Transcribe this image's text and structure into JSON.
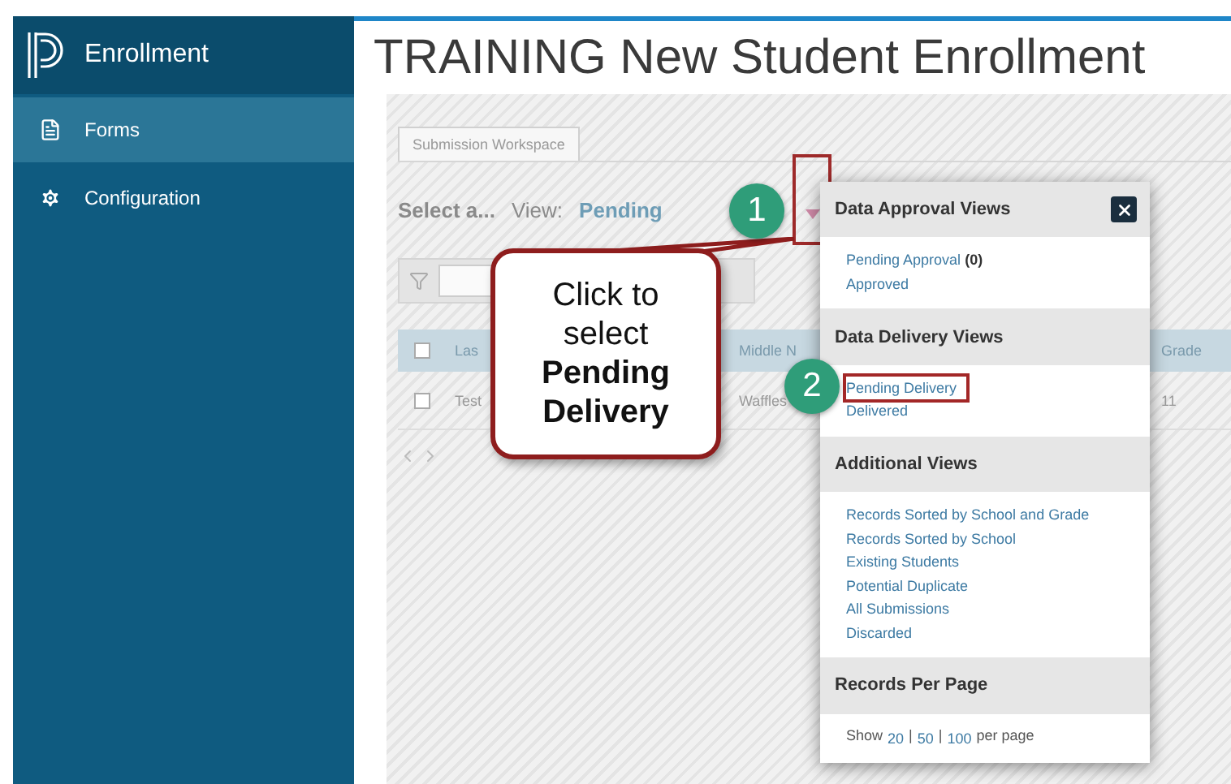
{
  "sidebar": {
    "app_title": "Enrollment",
    "items": [
      {
        "label": "Forms",
        "selected": true
      },
      {
        "label": "Configuration",
        "selected": false
      }
    ]
  },
  "page_title": "TRAINING New Student Enrollment",
  "tabs": [
    {
      "label": "Submission Workspace",
      "selected": true
    }
  ],
  "view_bar": {
    "select_label": "Select a...",
    "view_label": "View:",
    "view_value": "Pending"
  },
  "table": {
    "select_all_checked": false,
    "columns": [
      "Las",
      "Middle N",
      "Grade"
    ],
    "rows": [
      {
        "checked": false,
        "cells": [
          "Test",
          "Waffles",
          "11"
        ]
      }
    ]
  },
  "callout": {
    "text": "Click to select **Pending Delivery**"
  },
  "steps": [
    "1",
    "2"
  ],
  "dropdown": {
    "sections": [
      {
        "title": "Data Approval Views",
        "links": [
          {
            "label": "Pending Approval",
            "count": "(0)",
            "highlighted": false
          },
          {
            "label": "Approved",
            "highlighted": false
          }
        ]
      },
      {
        "title": "Data Delivery Views",
        "links": [
          {
            "label": "Pending Delivery",
            "highlighted": true
          },
          {
            "label": "Delivered",
            "highlighted": false
          }
        ]
      },
      {
        "title": "Additional Views",
        "links": [
          {
            "label": "Records Sorted by School and Grade",
            "highlighted": false
          },
          {
            "label": "Records Sorted by School",
            "highlighted": false
          },
          {
            "label": "Existing Students",
            "highlighted": false
          },
          {
            "label": "Potential Duplicate",
            "highlighted": false
          },
          {
            "label": "All Submissions",
            "highlighted": false
          },
          {
            "label": "Discarded",
            "highlighted": false
          }
        ]
      }
    ],
    "records_per_page": {
      "title": "Records Per Page",
      "prefix": "Show",
      "options": [
        "20",
        "50",
        "100"
      ],
      "separator": "|",
      "suffix": "per page"
    }
  }
}
